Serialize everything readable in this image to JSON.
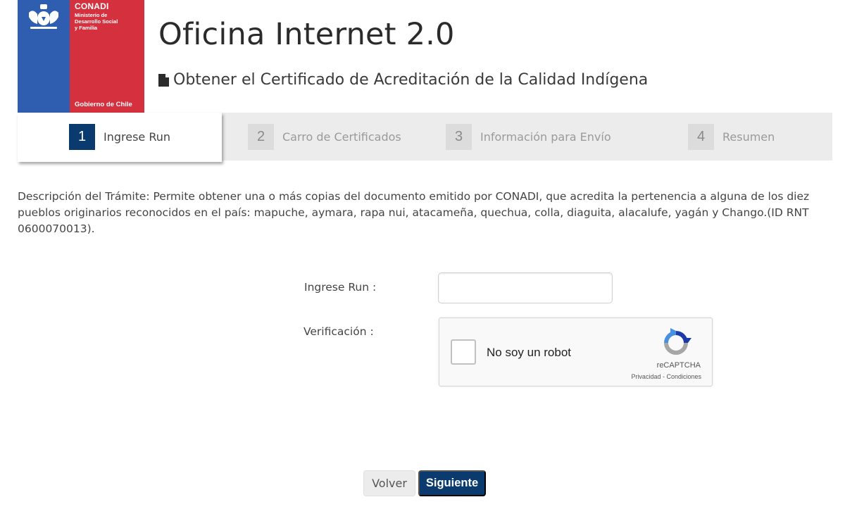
{
  "logo": {
    "org": "CONADI",
    "ministry": "Ministerio de\nDesarrollo Social\ny Familia",
    "government": "Gobierno de Chile",
    "colors": {
      "blue": "#2f5eb0",
      "red": "#d4303d"
    }
  },
  "header": {
    "title": "Oficina Internet 2.0",
    "subtitle_icon": "document-icon",
    "subtitle": "Obtener el Certificado de Acreditación de la Calidad Indígena"
  },
  "stepper": {
    "steps": [
      {
        "number": "1",
        "label": "Ingrese Run",
        "active": true
      },
      {
        "number": "2",
        "label": "Carro de Certificados",
        "active": false
      },
      {
        "number": "3",
        "label": "Información para Envío",
        "active": false
      },
      {
        "number": "4",
        "label": "Resumen",
        "active": false
      }
    ],
    "accent": "#0b3b6e"
  },
  "description": "Descripción del Trámite: Permite obtener una o más copias del documento emitido por CONADI, que acredita la pertenencia a alguna de los diez pueblos originarios reconocidos en el país: mapuche, aymara, rapa nui, atacameña, quechua, colla, diaguita, alacalufe, yagán y Chango.(ID RNT 0600070013).",
  "form": {
    "run_label": "Ingrese Run :",
    "run_value": "",
    "verification_label": "Verificación :"
  },
  "captcha": {
    "checkbox_label": "No soy un robot",
    "brand": "reCAPTCHA",
    "links": "Privacidad - Condiciones",
    "icon": "recaptcha-icon"
  },
  "buttons": {
    "back": "Volver",
    "next": "Siguiente"
  }
}
